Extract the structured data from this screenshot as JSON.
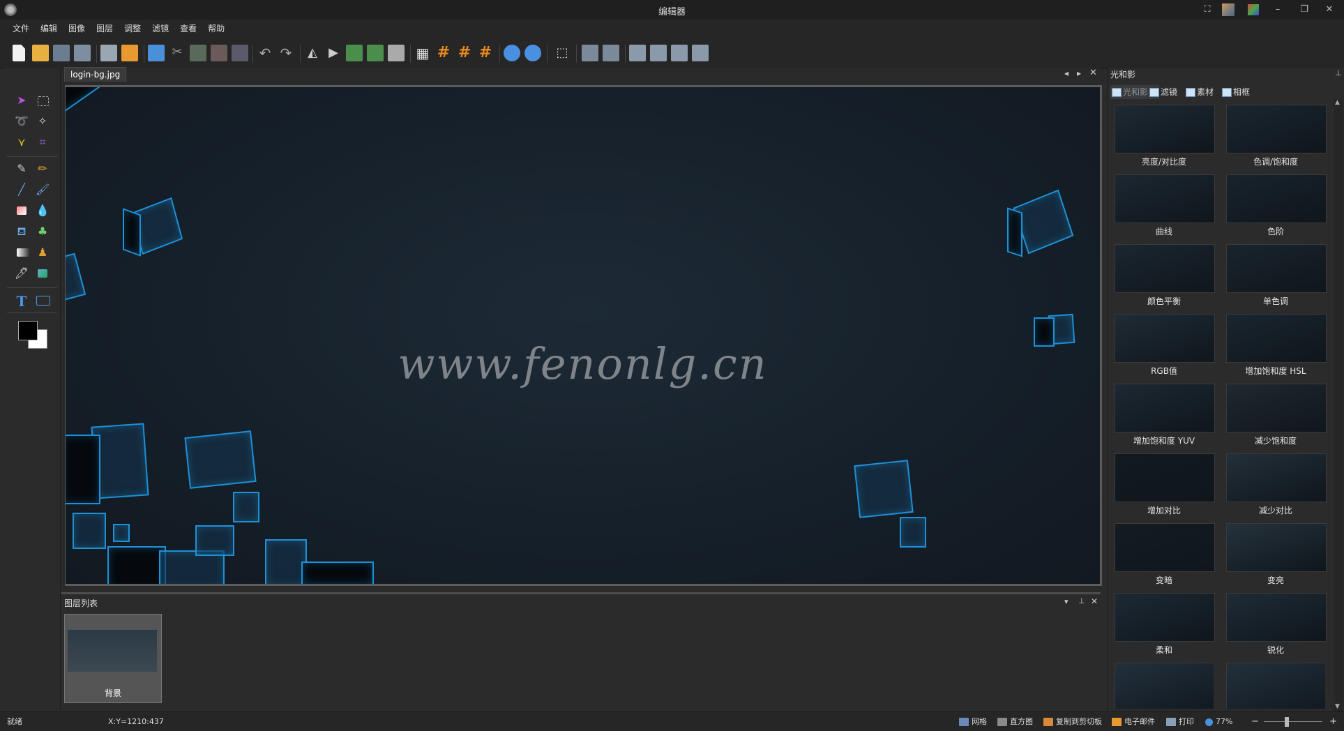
{
  "window": {
    "title": "编辑器"
  },
  "menu": [
    "文件",
    "编辑",
    "图像",
    "图层",
    "调整",
    "滤镜",
    "查看",
    "帮助"
  ],
  "document": {
    "tab_label": "login-bg.jpg",
    "watermark": "www.fenonlg.cn"
  },
  "right_panel": {
    "title": "光和影",
    "tabs": [
      "光和影",
      "滤镜",
      "素材",
      "相框"
    ],
    "active_tab": 0,
    "effects": [
      "亮度/对比度",
      "色调/饱和度",
      "曲线",
      "色阶",
      "颜色平衡",
      "单色调",
      "RGB值",
      "增加饱和度 HSL",
      "增加饱和度 YUV",
      "减少饱和度",
      "增加对比",
      "减少对比",
      "变暗",
      "变亮",
      "柔和",
      "锐化"
    ]
  },
  "layers_panel": {
    "title": "图层列表",
    "layers": [
      "背景"
    ]
  },
  "status": {
    "state": "就绪",
    "coords": "X:Y=1210:437",
    "grid": "网格",
    "histogram": "直方图",
    "copy": "复制到剪切板",
    "email": "电子邮件",
    "print": "打印",
    "zoom": "77%",
    "minus": "−",
    "plus": "+"
  },
  "colors": {
    "accent": "#1e90d6",
    "background": "#2b2b2b",
    "canvas": "#16202a"
  }
}
